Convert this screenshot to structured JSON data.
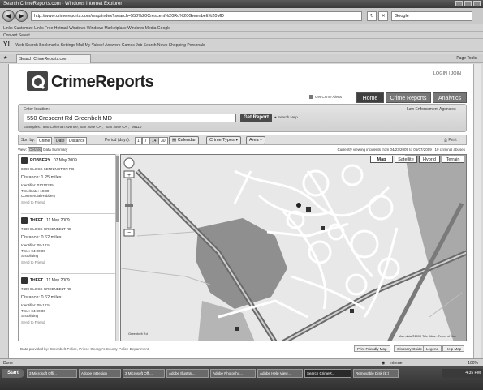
{
  "window": {
    "title": "Search CrimeReports.com - Windows Internet Explorer",
    "url": "http://www.crimereports.com/map/index?search=550%20Crescent%20Rd%20Greenbelt%20MD",
    "search_engine": "Google",
    "links_bar": "Links  Customize Links  Free Hotmail  Windows  Windows Marketplace  Windows Media  Google",
    "toolbar2": "Convert  Select",
    "toolbar3": "Web Search  Bookmarks  Settings  Mail  My Yahoo!  Answers  Games  Job Search  News  Shopping  Personals",
    "tab_label": "Search CrimeReports.com",
    "page_menu": "Page  Tools"
  },
  "site": {
    "logo": "CrimeReports",
    "login": "LOGIN | JOIN",
    "get_widget": "Get Crime Alerts",
    "nav": [
      "Home",
      "Crime Reports",
      "Analytics"
    ]
  },
  "search": {
    "label": "Enter location:",
    "value": "550 Crescent Rd Greenbelt MD",
    "button": "Get Report",
    "help": "Search Help",
    "examples": "Examples: \"580 Coleman Avenue, San Jose CA\", \"San Jose CA\", \"95110\"",
    "agencies": "Law Enforcement Agencies"
  },
  "filters": {
    "sort_label": "Sort by:",
    "sort_options": [
      "Crime",
      "Date",
      "Distance"
    ],
    "period_label": "Period (days):",
    "period_options": [
      "1",
      "7",
      "14",
      "30"
    ],
    "calendar": "Calendar",
    "crime_types": "Crime Types",
    "area": "Area",
    "print": "Print"
  },
  "view": {
    "label": "View:",
    "options": [
      "Details",
      "Data",
      "Summary"
    ],
    "summary": "Currently viewing incidents from 04/23/2009 to 05/07/2009 | 19 criminal abuses"
  },
  "incidents": [
    {
      "type": "ROBBERY",
      "date": "07 May 2009",
      "address": "8300 BLOCK KENNINGTON RD",
      "distance": "Distance: 1.25 miles",
      "identifier": "Identifier: 01210235",
      "time": "Time/Date: 10:30",
      "detail": "Commercial Robbery",
      "more": "Send to Friend"
    },
    {
      "type": "THEFT",
      "date": "11 May 2009",
      "address": "7400 BLOCK GREENBELT RD",
      "distance": "Distance: 0.62 miles",
      "identifier": "Identifier: 09-1234",
      "time": "Time: 04:00:00",
      "detail": "Shoplifting",
      "more": "Send to Friend"
    },
    {
      "type": "THEFT",
      "date": "11 May 2009",
      "address": "7400 BLOCK GREENBELT RD",
      "distance": "Distance: 0.62 miles",
      "identifier": "Identifier: 09-1234",
      "time": "Time: 04:00:00",
      "detail": "Shoplifting",
      "more": "Send to Friend"
    }
  ],
  "map": {
    "types": [
      "Map",
      "Satellite",
      "Hybrid",
      "Terrain"
    ],
    "copyright": "Map data ©2009 Tele Atlas - Terms of Use",
    "scale": "Greenbelt Rd"
  },
  "footer": {
    "note": "Data provided by: Greenbelt Police, Prince George's County Police Department",
    "buttons": [
      "Print Friendly Map",
      "Glossary Guide",
      "Legend",
      "Help Map"
    ]
  },
  "status": {
    "left": "Done",
    "zone": "Internet",
    "zoom": "100%"
  },
  "taskbar": {
    "start": "Start",
    "tasks": [
      "3 Microsoft Offi...",
      "Adobe InDesign",
      "3 Microsoft Offi...",
      "Adobe Illustrat...",
      "Adobe Photosho...",
      "Adobe Help View...",
      "Search CrimeR...",
      "Removable Disk (E:)"
    ],
    "clock": "4:35 PM"
  }
}
